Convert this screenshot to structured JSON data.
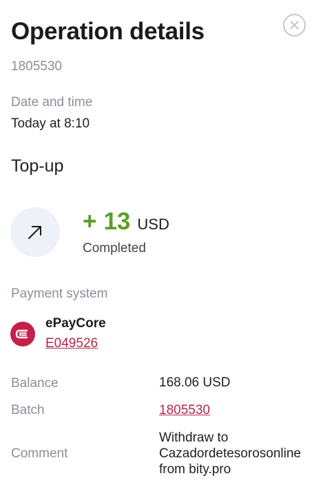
{
  "header": {
    "title": "Operation details",
    "operation_id": "1805530"
  },
  "close_icon": "close-icon",
  "date": {
    "label": "Date and time",
    "value": "Today at 8:10"
  },
  "operation": {
    "type": "Top-up",
    "icon": "arrow-up-right-icon",
    "sign": "+",
    "amount": "13",
    "currency": "USD",
    "status": "Completed",
    "amount_color": "#5b9e2a"
  },
  "payment_system": {
    "label": "Payment system",
    "name": "ePayCore",
    "account": "E049526",
    "brand_color": "#c42049"
  },
  "details": {
    "balance_label": "Balance",
    "balance_value": "168.06 USD",
    "batch_label": "Batch",
    "batch_value": "1805530",
    "comment_label": "Comment",
    "comment_lines": [
      "Withdraw to",
      "Cazadordetesorosonline",
      "from bity.pro"
    ]
  }
}
